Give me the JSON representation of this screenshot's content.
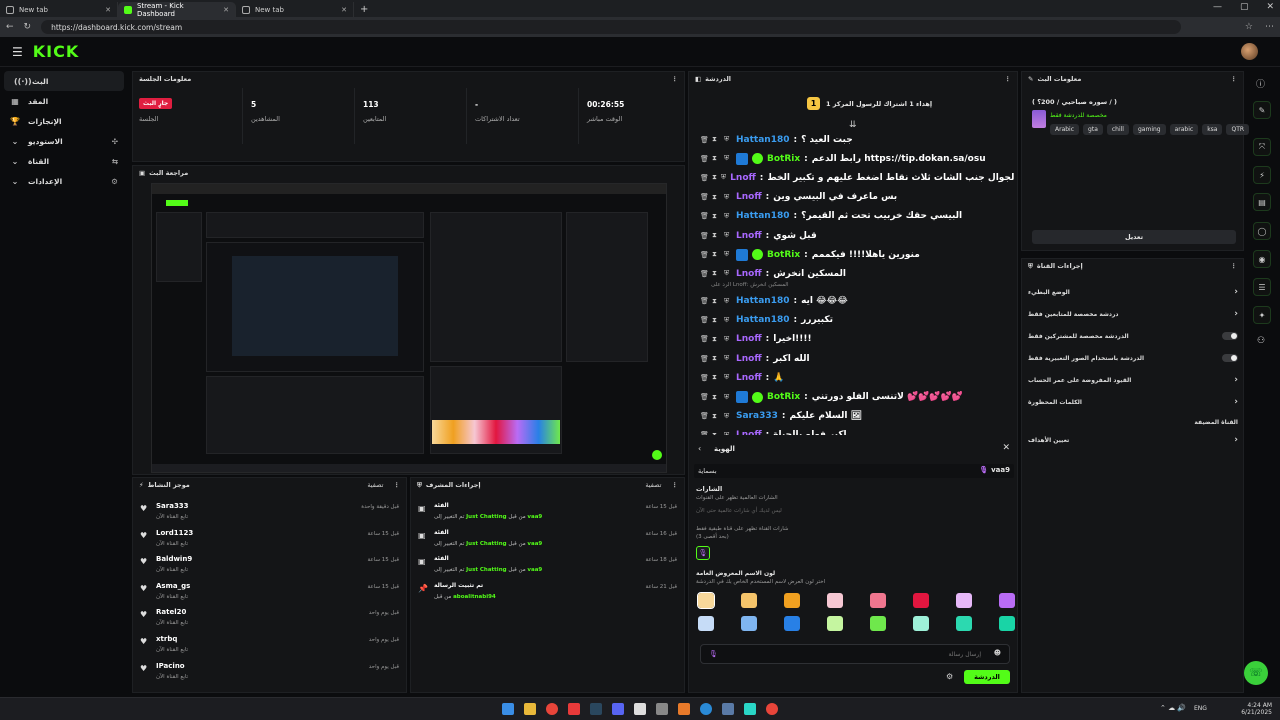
{
  "browser": {
    "tabs": [
      {
        "label": "New tab"
      },
      {
        "label": "Stream - Kick Dashboard"
      },
      {
        "label": "New tab"
      }
    ],
    "url": "https://dashboard.kick.com/stream"
  },
  "header": {
    "logo": "KICK"
  },
  "nav": {
    "items": [
      {
        "label": "البث",
        "icon": "live-icon"
      },
      {
        "label": "المقد",
        "icon": "content-icon"
      },
      {
        "label": "الإنجازات",
        "icon": "trophy-icon"
      },
      {
        "label": "الاستوديو",
        "icon": "studio-icon"
      },
      {
        "label": "القناة",
        "icon": "channel-icon"
      },
      {
        "label": "الإعدادات",
        "icon": "gear-icon"
      }
    ]
  },
  "session": {
    "title": "معلومات الجلسة",
    "live_badge": "جارٍ البث",
    "live_label": "الجلسة",
    "viewers_value": "5",
    "viewers_label": "المشاهدين",
    "followers_value": "113",
    "followers_label": "المتابعين",
    "subs_value": "-",
    "subs_label": "تعداد الاشتراكات",
    "time_value": "00:26:55",
    "time_label": "الوقت مباشر"
  },
  "preview": {
    "title": "مراجعة البث"
  },
  "activity": {
    "title": "موجز النشاط",
    "filter": "تصفية",
    "rows": [
      {
        "name": "Sara333",
        "sub": "تابع القناة الآن",
        "time": "قبل دقيقة واحدة"
      },
      {
        "name": "Lord1123",
        "sub": "تابع القناة الآن",
        "time": "قبل 15 ساعة"
      },
      {
        "name": "Baldwin9",
        "sub": "تابع القناة الآن",
        "time": "قبل 15 ساعة"
      },
      {
        "name": "Asma_gs",
        "sub": "تابع القناة الآن",
        "time": "قبل 15 ساعة"
      },
      {
        "name": "Ratel20",
        "sub": "تابع القناة الآن",
        "time": "قبل يوم واحد"
      },
      {
        "name": "xtrbq",
        "sub": "تابع القناة الآن",
        "time": "قبل يوم واحد"
      },
      {
        "name": "IPacino",
        "sub": "تابع القناة الآن",
        "time": "قبل يوم واحد"
      }
    ]
  },
  "mod": {
    "title": "إجراءات المشرف",
    "filter": "تصفية",
    "rows": [
      {
        "title": "الفئة",
        "sub_pre": "من قبل",
        "user": "vaa9",
        "sub_mid": "تم التغيير إلى",
        "cat": "Just Chatting",
        "time": "قبل 15 ساعة"
      },
      {
        "title": "الفئة",
        "sub_pre": "من قبل",
        "user": "vaa9",
        "sub_mid": "تم التغيير إلى",
        "cat": "Just Chatting",
        "time": "قبل 16 ساعة"
      },
      {
        "title": "الفئة",
        "sub_pre": "من قبل",
        "user": "vaa9",
        "sub_mid": "تم التغيير إلى",
        "cat": "Just Chatting",
        "time": "قبل 18 ساعة"
      },
      {
        "title": "تم تثبيت الرسالة",
        "sub_pre": "من قبل",
        "user": "aboalitnabi94",
        "sub_mid": "",
        "cat": "",
        "time": "قبل 21 ساعة"
      }
    ]
  },
  "chat": {
    "title": "الدردشة",
    "pinned": "إهداء 1 اشتراك للرسول المركز 1",
    "reply_hint": "الرد على Lnoff: المسكين انخرش",
    "messages": [
      {
        "user": "Hattan180",
        "color": "#3a9cf0",
        "bot": false,
        "text": "جبت العيد ؟"
      },
      {
        "user": "BotRix",
        "color": "#53fc18",
        "bot": true,
        "text": "رابط الدعم https://tip.dokan.sa/osu"
      },
      {
        "user": "Lnoff",
        "color": "#a968ff",
        "bot": false,
        "text": "ياخي في الجوال جنب الشات ثلاث نقاط اضغط عليهم و تكبير الخط"
      },
      {
        "user": "Lnoff",
        "color": "#a968ff",
        "bot": false,
        "text": "بس ماعرف في البيسي وين"
      },
      {
        "user": "Hattan180",
        "color": "#3a9cf0",
        "bot": false,
        "text": "البيسي حقك خربيب تحت ثم القيمر؟"
      },
      {
        "user": "Lnoff",
        "color": "#a968ff",
        "bot": false,
        "text": "قبل شوي"
      },
      {
        "user": "BotRix",
        "color": "#53fc18",
        "bot": true,
        "text": "منورين ياهلا!!!! فيكممم"
      },
      {
        "user": "Lnoff",
        "color": "#a968ff",
        "bot": false,
        "text": "المسكين انخرش"
      },
      {
        "user": "Hattan180",
        "color": "#3a9cf0",
        "bot": false,
        "text": "ايه 😂😂😂"
      },
      {
        "user": "Hattan180",
        "color": "#3a9cf0",
        "bot": false,
        "text": "تكبيررر"
      },
      {
        "user": "Lnoff",
        "color": "#a968ff",
        "bot": false,
        "text": "اخيرا!!!!"
      },
      {
        "user": "Lnoff",
        "color": "#a968ff",
        "bot": false,
        "text": "الله اكبر"
      },
      {
        "user": "Lnoff",
        "color": "#a968ff",
        "bot": false,
        "text": "🙏"
      },
      {
        "user": "BotRix",
        "color": "#53fc18",
        "bot": true,
        "text": "لاتنسى الفلو دورتني 💕💕💕💕💕"
      },
      {
        "user": "Sara333",
        "color": "#3a9cf0",
        "bot": false,
        "text": "السلام عليكم 🖼"
      },
      {
        "user": "Lnoff",
        "color": "#a968ff",
        "bot": false,
        "text": "اكبر فولو بالحياة"
      }
    ]
  },
  "identity": {
    "title": "الهوية",
    "username": "vaa9",
    "nickname": "بسماية",
    "badges_title": "الشارات",
    "badges_desc": "الشارات العالمية تظهر على القنوات",
    "badges_empty": "ليس لديك أي شارات عالمية حتى الآن",
    "channel_badges_desc": "شارات القناة تظهر على قناة طبقية فقط",
    "channel_badges_limit": "(بحد أقصى 3)",
    "color_title": "لون الاسم المعروض العامة",
    "color_desc": "اختر لون العرض لاسم المستخدم الخاص بك في الدردشة",
    "colors": [
      "#f8d89a",
      "#f5c46a",
      "#f0a020",
      "#f6c7d3",
      "#f0768f",
      "#e2163f",
      "#e6b8f8",
      "#b96cf5",
      "#c6dcf7",
      "#7fb5f0",
      "#2880e6",
      "#c5f5a0",
      "#6fe84c",
      "#9ef0d8",
      "#2cd9b0",
      "#19d4a6"
    ],
    "message_placeholder": "إرسال رسالة",
    "chat_button": "الدردشة"
  },
  "stream_info": {
    "title": "معلومات البث",
    "stream_title": "( سوره صباحيي / 200؟ / )",
    "category": "مخصصة للدردشة فقط",
    "tags": [
      "Arabic",
      "gta",
      "chill",
      "gaming",
      "arabic",
      "ksa",
      "QTR"
    ],
    "edit_button": "تعديل"
  },
  "channel_actions": {
    "title": "إجراءات القناة",
    "items": [
      {
        "label": "الوضع البطيء",
        "type": "chevron"
      },
      {
        "label": "دردشة مخصصة للمتابعين فقط",
        "type": "chevron"
      },
      {
        "label": "الدردشة مخصصة للمشتركين فقط",
        "type": "toggle"
      },
      {
        "label": "الدردشة باستخدام الصور التعبيرية فقط",
        "type": "toggle"
      },
      {
        "label": "القيود المفروضة على عمر الحساب",
        "type": "chevron"
      },
      {
        "label": "الكلمات المحظورة",
        "type": "chevron"
      },
      {
        "label": "القناة المضيفة",
        "type": "none"
      },
      {
        "label": "تعيين الأهداف",
        "type": "chevron"
      }
    ]
  },
  "taskbar": {
    "lang": "ENG",
    "time": "4:24 AM",
    "date": "6/21/2025"
  }
}
